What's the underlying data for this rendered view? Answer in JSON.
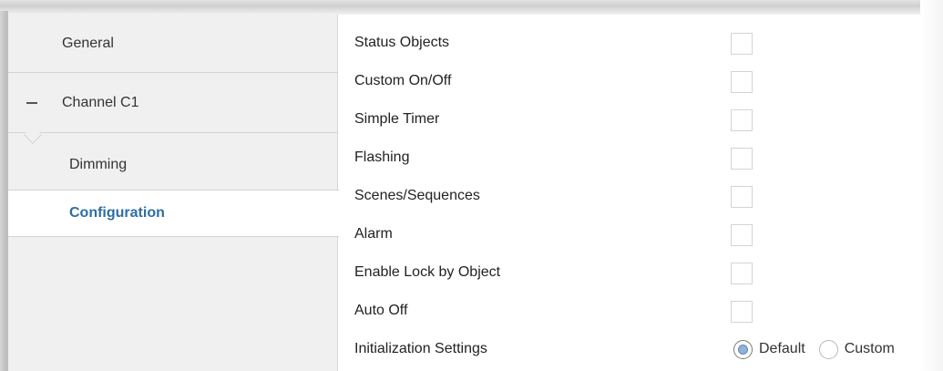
{
  "sidebar": {
    "items": [
      {
        "label": "General"
      },
      {
        "label": "Channel C1",
        "expanded": true,
        "toggle_icon": "minus-icon"
      },
      {
        "label": "Dimming"
      },
      {
        "label": "Configuration",
        "selected": true
      }
    ]
  },
  "params": [
    {
      "label": "Status Objects",
      "type": "checkbox",
      "checked": false
    },
    {
      "label": "Custom On/Off",
      "type": "checkbox",
      "checked": false
    },
    {
      "label": "Simple Timer",
      "type": "checkbox",
      "checked": false
    },
    {
      "label": "Flashing",
      "type": "checkbox",
      "checked": false
    },
    {
      "label": "Scenes/Sequences",
      "type": "checkbox",
      "checked": false
    },
    {
      "label": "Alarm",
      "type": "checkbox",
      "checked": false
    },
    {
      "label": "Enable Lock by Object",
      "type": "checkbox",
      "checked": false
    },
    {
      "label": "Auto Off",
      "type": "checkbox",
      "checked": false
    },
    {
      "label": "Initialization Settings",
      "type": "radio",
      "options": [
        {
          "label": "Default",
          "selected": true
        },
        {
          "label": "Custom",
          "selected": false
        }
      ]
    }
  ],
  "colors": {
    "selected_text": "#2e6ea6",
    "sidebar_bg": "#f0f0f0",
    "radio_selected": "#8fb3d9"
  }
}
